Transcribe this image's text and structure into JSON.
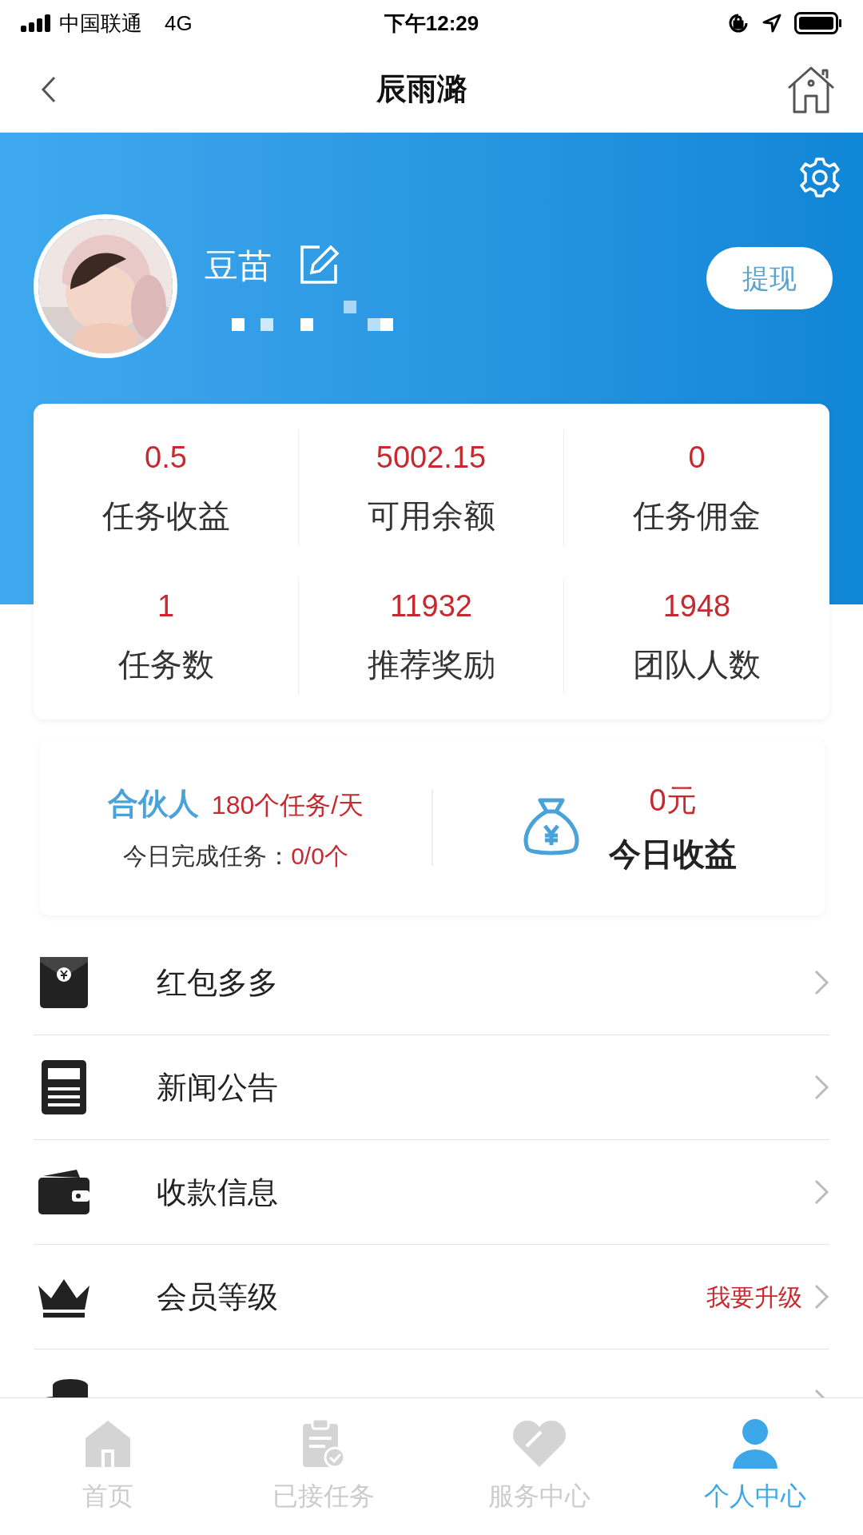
{
  "status_bar": {
    "carrier": "中国联通",
    "network": "4G",
    "time": "下午12:29"
  },
  "nav": {
    "title": "辰雨潞"
  },
  "profile": {
    "name": "豆苗",
    "withdraw_button": "提现"
  },
  "stats": [
    {
      "value": "0.5",
      "label": "任务收益"
    },
    {
      "value": "5002.15",
      "label": "可用余额"
    },
    {
      "value": "0",
      "label": "任务佣金"
    },
    {
      "value": "1",
      "label": "任务数"
    },
    {
      "value": "11932",
      "label": "推荐奖励"
    },
    {
      "value": "1948",
      "label": "团队人数"
    }
  ],
  "partner": {
    "level": "合伙人",
    "quota": "180个任务/天",
    "done_label": "今日完成任务：",
    "done_value": "0/0个",
    "today_amount": "0元",
    "today_label": "今日收益"
  },
  "menu": [
    {
      "kind": "envelope",
      "label": "红包多多"
    },
    {
      "kind": "news",
      "label": "新闻公告"
    },
    {
      "kind": "wallet",
      "label": "收款信息"
    },
    {
      "kind": "crown",
      "label": "会员等级",
      "note": "我要升级"
    },
    {
      "kind": "coins"
    }
  ],
  "tabs": [
    {
      "kind": "home",
      "label": "首页",
      "selected": false
    },
    {
      "kind": "clipboard",
      "label": "已接任务",
      "selected": false
    },
    {
      "kind": "heart",
      "label": "服务中心",
      "selected": false
    },
    {
      "kind": "person",
      "label": "个人中心",
      "selected": true
    }
  ]
}
